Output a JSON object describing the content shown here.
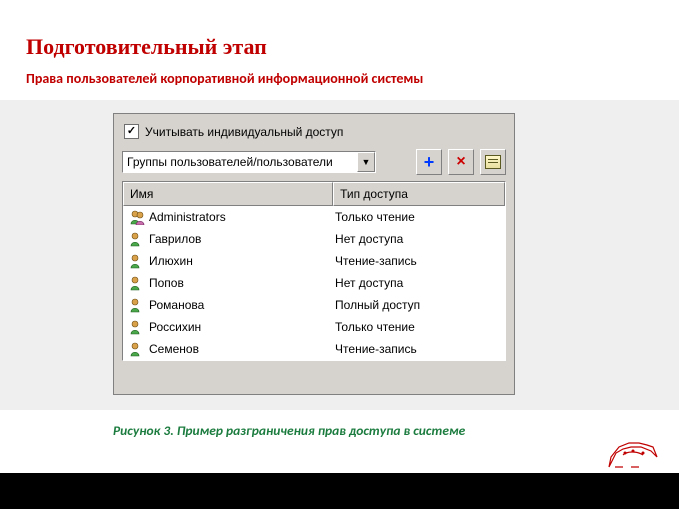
{
  "header": {
    "title": "Подготовительный этап",
    "subtitle": "Права пользователей корпоративной информационной системы"
  },
  "panel": {
    "checkbox_label": "Учитывать индивидуальный доступ",
    "dropdown_label": "Группы пользователей/пользователи",
    "icons": {
      "add": "+",
      "delete": "×"
    },
    "columns": {
      "name": "Имя",
      "type": "Тип доступа"
    },
    "rows": [
      {
        "name": "Administrators",
        "type": "Только чтение",
        "kind": "group"
      },
      {
        "name": "Гаврилов",
        "type": "Нет доступа",
        "kind": "user"
      },
      {
        "name": "Илюхин",
        "type": "Чтение-запись",
        "kind": "user"
      },
      {
        "name": "Попов",
        "type": "Нет доступа",
        "kind": "user"
      },
      {
        "name": "Романова",
        "type": "Полный доступ",
        "kind": "user"
      },
      {
        "name": "Россихин",
        "type": "Только чтение",
        "kind": "user"
      },
      {
        "name": "Семенов",
        "type": "Чтение-запись",
        "kind": "user"
      }
    ]
  },
  "caption": "Рисунок 3. Пример разграничения прав доступа в системе"
}
